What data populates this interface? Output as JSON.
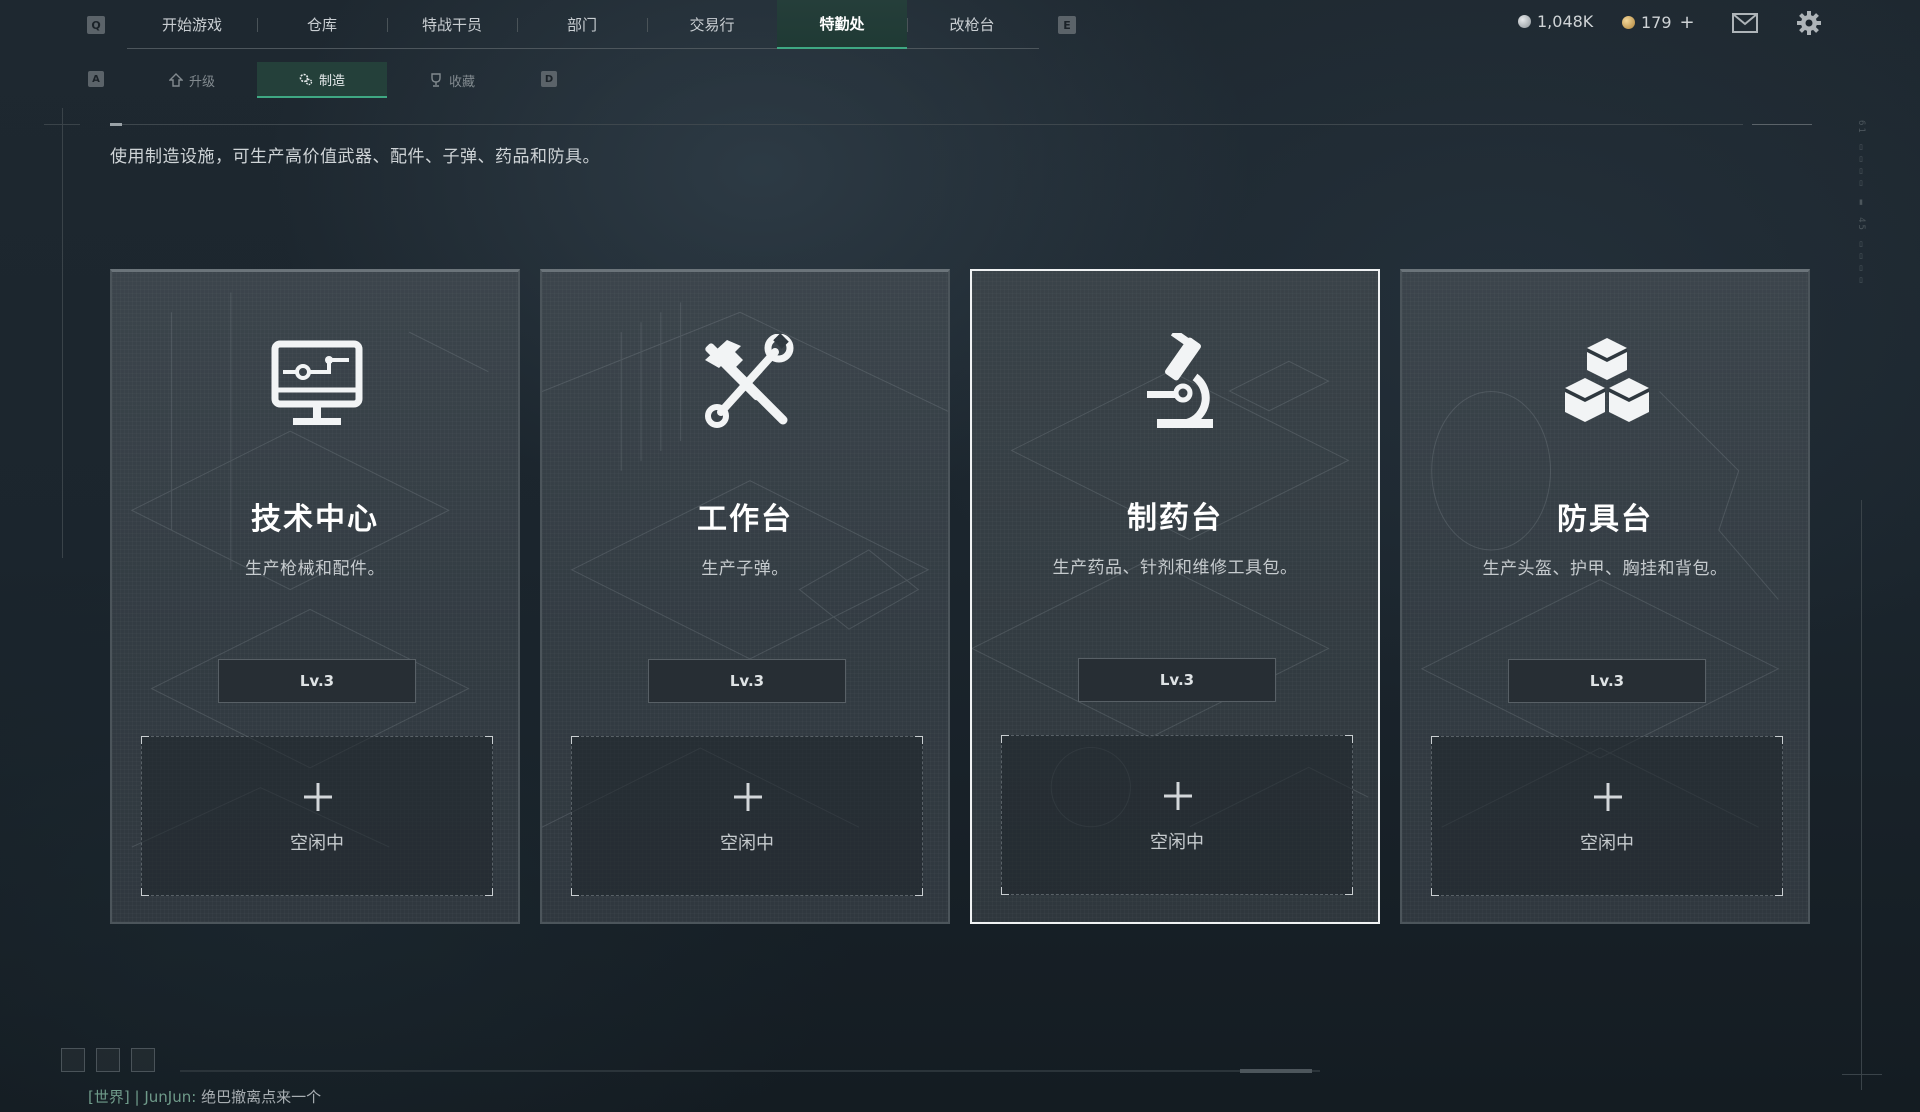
{
  "top_bar": {
    "left_key": "Q",
    "right_key": "E",
    "tabs": [
      {
        "label": "开始游戏"
      },
      {
        "label": "仓库"
      },
      {
        "label": "特战干员"
      },
      {
        "label": "部门"
      },
      {
        "label": "交易行"
      },
      {
        "label": "特勤处",
        "active": true
      },
      {
        "label": "改枪台"
      }
    ],
    "currency_silver": "1,048K",
    "currency_gold": "179",
    "currency_gold_add": "+",
    "icons": [
      "mail-icon",
      "gear-icon"
    ]
  },
  "sub_tabs": {
    "left_key": "A",
    "right_key": "D",
    "items": [
      {
        "label": "升级",
        "icon": "upgrade-icon"
      },
      {
        "label": "制造",
        "icon": "gears-icon",
        "active": true
      },
      {
        "label": "收藏",
        "icon": "trophy-icon"
      }
    ]
  },
  "description": "使用制造设施，可生产高价值武器、配件、子弹、药品和防具。",
  "cards": [
    {
      "title": "技术中心",
      "subtitle": "生产枪械和配件。",
      "level": "Lv.3",
      "slot_status": "空闲中",
      "icon": "computer-icon"
    },
    {
      "title": "工作台",
      "subtitle": "生产子弹。",
      "level": "Lv.3",
      "slot_status": "空闲中",
      "icon": "hammer-wrench-icon"
    },
    {
      "title": "制药台",
      "subtitle": "生产药品、针剂和维修工具包。",
      "level": "Lv.3",
      "slot_status": "空闲中",
      "icon": "microscope-icon",
      "selected": true
    },
    {
      "title": "防具台",
      "subtitle": "生产头盔、护甲、胸挂和背包。",
      "level": "Lv.3",
      "slot_status": "空闲中",
      "icon": "cubes-icon"
    }
  ],
  "chat": {
    "channel": "[世界]",
    "separator": "|",
    "user": "JunJun:",
    "message": "绝巴撤离点来一个"
  },
  "colors": {
    "accent_green": "#3fa883",
    "active_tab_bg": "#24403a",
    "background": "#1b252d",
    "card_bg": "#363f46",
    "selected_border": "#f0f2f3"
  }
}
